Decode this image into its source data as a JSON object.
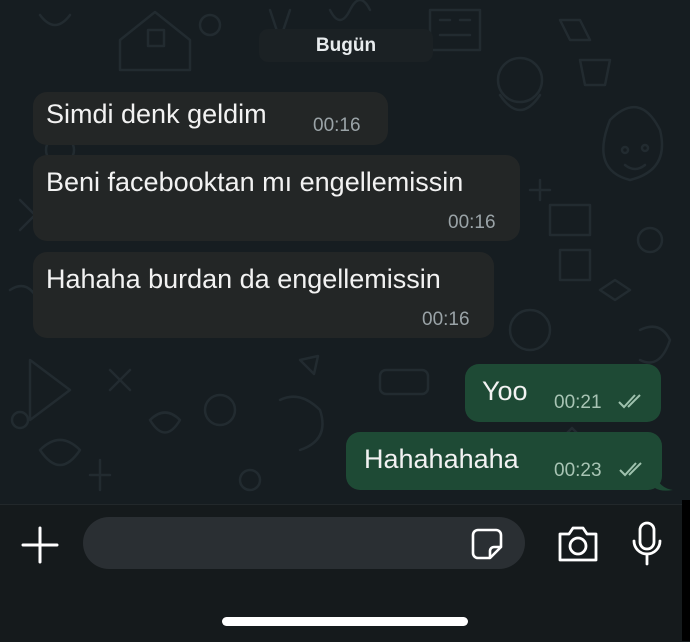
{
  "chat": {
    "date_label": "Bugün",
    "messages": [
      {
        "direction": "incoming",
        "text": "Simdi denk geldim",
        "time": "00:16"
      },
      {
        "direction": "incoming",
        "text": "Beni facebooktan mı engellemissin",
        "time": "00:16"
      },
      {
        "direction": "incoming",
        "text": "Hahaha burdan da engellemissin",
        "time": "00:16"
      },
      {
        "direction": "outgoing",
        "text": "Yoo",
        "time": "00:21",
        "status": "read-ticks-icon"
      },
      {
        "direction": "outgoing",
        "text": "Hahahahaha",
        "time": "00:23",
        "status": "read-ticks-icon"
      }
    ]
  },
  "input_bar": {
    "message_placeholder": "",
    "icons": [
      "plus-icon",
      "sticker-icon",
      "camera-icon",
      "microphone-icon"
    ]
  },
  "colors": {
    "chat_background": "#161d21",
    "incoming_bubble": "#232626",
    "outgoing_bubble": "#1e4a35",
    "input_bar": "#151a1c"
  }
}
